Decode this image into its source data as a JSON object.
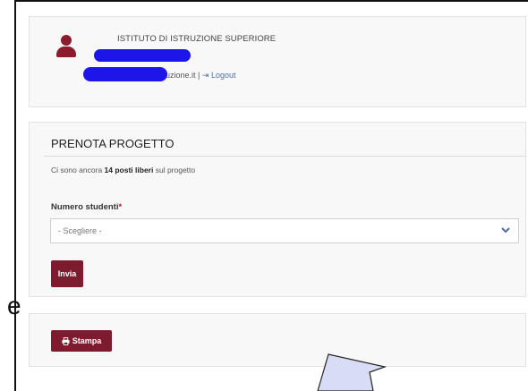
{
  "header": {
    "school_name": "ISTITUTO DI ISTRUZIONE SUPERIORE",
    "email_visible": "istruzione.it",
    "separator": "|",
    "logout_label": "Logout"
  },
  "booking": {
    "title": "PRENOTA PROGETTO",
    "info_prefix": "Ci sono ancora",
    "info_bold": "14 posti liberi",
    "info_suffix": "sul progetto",
    "field_label": "Numero studenti",
    "required_mark": "*",
    "select_value": "- Scegliere -",
    "submit_label": "Invia"
  },
  "print": {
    "label": "Stampa"
  },
  "stray_text": "e",
  "colors": {
    "accent": "#7d1c2f",
    "redaction": "#1c17e8",
    "link": "#4a6fa5",
    "cursor_fill": "#d9dcf5"
  }
}
